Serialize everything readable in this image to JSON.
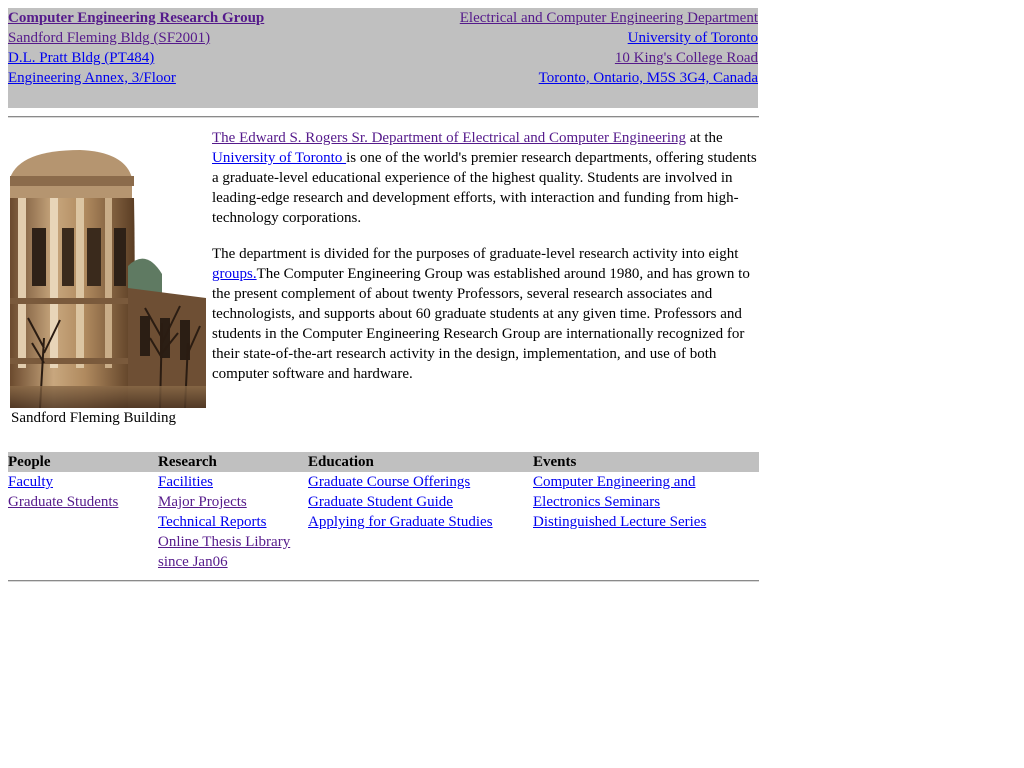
{
  "header": {
    "left": [
      {
        "text": "Computer Engineering Research Group",
        "state": "visited"
      },
      {
        "text": "Sandford Fleming Bldg (SF2001)",
        "state": "visited"
      },
      {
        "text": "D.L. Pratt Bldg (PT484)",
        "state": "unvisited"
      },
      {
        "text": "Engineering Annex, 3/Floor",
        "state": "unvisited"
      }
    ],
    "right": [
      {
        "text": "Electrical and Computer Engineering Department",
        "state": "visited"
      },
      {
        "text": "University of Toronto",
        "state": "unvisited"
      },
      {
        "text": "10 King's College Road",
        "state": "visited"
      },
      {
        "text": "Toronto, Ontario, M5S 3G4, Canada",
        "state": "unvisited"
      }
    ]
  },
  "photo": {
    "caption": "Sandford Fleming Building"
  },
  "intro": {
    "p1_link1": "The Edward S. Rogers Sr. Department of Electrical and Computer Engineering",
    "p1_text1": " at the ",
    "p1_link2": "University of Toronto ",
    "p1_text2": "is one of the world's premier research departments, offering students a graduate-level educational experience of the highest quality. Students are involved in leading-edge research and development efforts, with interaction and funding from high-technology corporations.",
    "p2_text1": "The department is divided for the purposes of graduate-level research activity into eight ",
    "p2_link": "groups.",
    "p2_text2": "The Computer Engineering Group was established around 1980, and has grown to the present complement of about twenty Professors, several research associates and technologists, and supports about 60 graduate students at any given time. Professors and students in the Computer Engineering Research Group are internationally recognized for their state-of-the-art research activity in the design, implementation, and use of both computer software and hardware."
  },
  "nav": {
    "headers": [
      "People",
      "Research",
      "Education",
      "Events"
    ],
    "people": [
      "Faculty",
      "Graduate Students"
    ],
    "research": [
      "Facilities",
      "Major Projects",
      "Technical Reports",
      "Online Thesis Library",
      "since Jan06"
    ],
    "education": [
      "Graduate Course Offerings",
      "Graduate Student Guide",
      "Applying for Graduate Studies"
    ],
    "events": [
      "Computer Engineering and",
      "Electronics Seminars",
      "Distinguished Lecture Series"
    ]
  },
  "colors": {
    "banner_bg": "#c0c0c0",
    "link_unvisited": "#0000ee",
    "link_visited": "#551a8b"
  }
}
